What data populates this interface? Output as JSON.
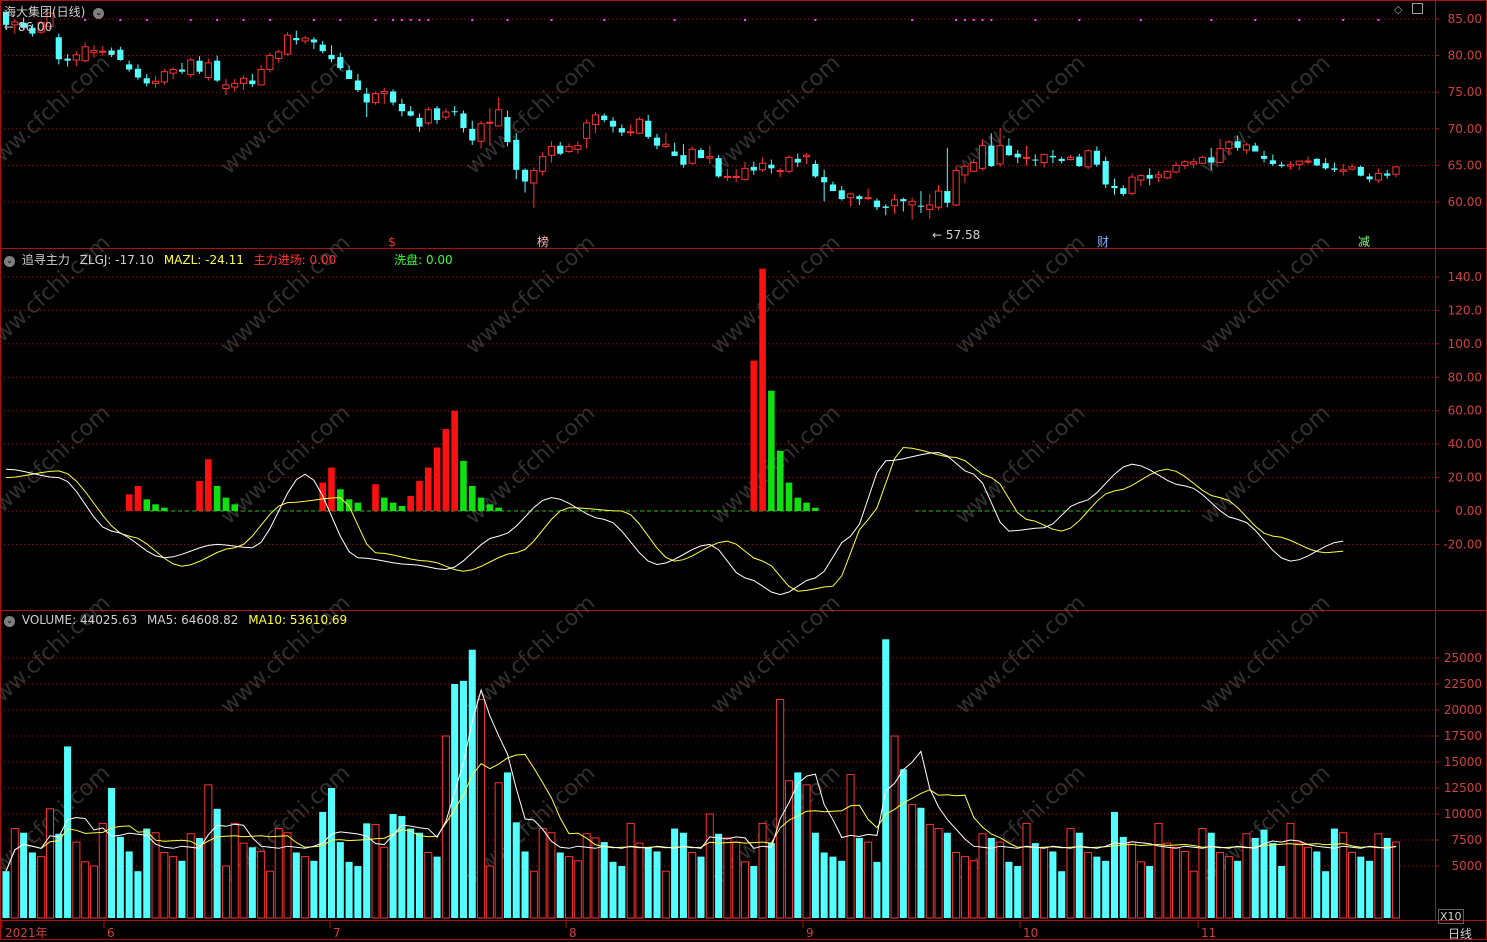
{
  "panel_top": {
    "title": "海大集团(日线)",
    "max_label": "86.00",
    "min_label": "57.58",
    "axis_ticks": [
      "85.00",
      "80.00",
      "75.00",
      "70.00",
      "65.00",
      "60.00"
    ],
    "markers": [
      "$",
      "榜",
      "财",
      "减"
    ],
    "colors": {
      "up": "#ff3232",
      "down": "#54ffff",
      "marker_s": "#ff3232",
      "marker_bang": "#ffb0b0",
      "marker_cai": "#7fb0ff",
      "marker_jian": "#7fff7f"
    }
  },
  "panel_mid": {
    "name": "追寻主力",
    "zlgj_label": "ZLGJ:",
    "zlgj_value": "-17.10",
    "mazl_label": "MAZL:",
    "mazl_value": "-24.11",
    "entry_label": "主力进场:",
    "entry_value": "0.00",
    "wash_label": "洗盘:",
    "wash_value": "0.00",
    "axis_ticks": [
      "140.0",
      "120.0",
      "100.0",
      "80.00",
      "60.00",
      "40.00",
      "20.00",
      "0.00",
      "-20.00"
    ]
  },
  "panel_vol": {
    "name": "VOLUME:",
    "value": "44025.63",
    "ma5_label": "MA5:",
    "ma5_value": "64608.82",
    "ma10_label": "MA10:",
    "ma10_value": "53610.69",
    "axis_ticks": [
      "25000",
      "22500",
      "20000",
      "17500",
      "15000",
      "12500",
      "10000",
      "7500",
      "5000"
    ],
    "multiplier": "X10"
  },
  "x_axis": {
    "labels": [
      "2021年",
      "6",
      "7",
      "8",
      "9",
      "10",
      "11"
    ],
    "period": "日线"
  },
  "watermark": "www.cfchi.com",
  "chart_data": {
    "type": "candlestick",
    "price": {
      "ylim": [
        57.0,
        86.5
      ],
      "ohlc": [
        [
          86.0,
          86.0,
          83.5,
          84.2
        ],
        [
          84.2,
          85.0,
          83.0,
          84.6
        ],
        [
          84.5,
          85.2,
          83.5,
          83.8
        ],
        [
          83.8,
          84.3,
          82.6,
          83.0
        ],
        [
          83.2,
          84.8,
          83.0,
          84.5
        ],
        [
          84.0,
          86.0,
          83.6,
          85.8
        ],
        [
          82.5,
          83.0,
          78.8,
          79.5
        ],
        [
          79.6,
          80.2,
          78.5,
          79.3
        ],
        [
          79.4,
          80.6,
          78.6,
          80.1
        ],
        [
          79.3,
          81.8,
          79.1,
          81.2
        ],
        [
          80.4,
          81.4,
          79.7,
          80.7
        ],
        [
          80.6,
          81.3,
          80.0,
          80.6
        ],
        [
          80.7,
          81.1,
          79.8,
          80.1
        ],
        [
          80.8,
          81.2,
          79.3,
          79.4
        ],
        [
          78.8,
          79.3,
          77.8,
          78.1
        ],
        [
          78.2,
          78.8,
          76.7,
          77.0
        ],
        [
          76.9,
          77.5,
          75.8,
          76.2
        ],
        [
          76.2,
          77.2,
          75.6,
          76.5
        ],
        [
          76.4,
          78.2,
          76.0,
          77.8
        ],
        [
          77.6,
          78.4,
          76.8,
          78.1
        ],
        [
          78.1,
          79.0,
          77.5,
          77.8
        ],
        [
          77.4,
          79.7,
          77.0,
          79.4
        ],
        [
          79.3,
          79.9,
          77.5,
          77.8
        ],
        [
          77.0,
          79.6,
          76.6,
          79.0
        ],
        [
          79.3,
          80.0,
          76.4,
          76.6
        ],
        [
          75.5,
          76.8,
          74.6,
          76.0
        ],
        [
          75.7,
          76.8,
          75.1,
          76.2
        ],
        [
          76.2,
          77.3,
          75.3,
          76.9
        ],
        [
          76.6,
          77.5,
          75.7,
          76.1
        ],
        [
          76.0,
          78.7,
          75.9,
          78.1
        ],
        [
          78.1,
          80.4,
          77.7,
          80.0
        ],
        [
          79.6,
          80.8,
          79.0,
          80.5
        ],
        [
          80.2,
          83.2,
          80.0,
          82.8
        ],
        [
          82.4,
          83.4,
          81.5,
          82.1
        ],
        [
          82.0,
          82.7,
          81.6,
          82.4
        ],
        [
          82.2,
          82.5,
          80.9,
          81.8
        ],
        [
          81.5,
          82.0,
          80.3,
          80.6
        ],
        [
          80.1,
          81.4,
          79.1,
          79.5
        ],
        [
          79.8,
          80.4,
          78.0,
          78.3
        ],
        [
          78.0,
          78.6,
          76.8,
          76.8
        ],
        [
          76.6,
          77.5,
          75.0,
          75.3
        ],
        [
          74.8,
          75.6,
          71.6,
          73.6
        ],
        [
          73.6,
          75.1,
          73.3,
          74.8
        ],
        [
          74.8,
          75.6,
          73.4,
          75.1
        ],
        [
          75.1,
          75.4,
          73.2,
          73.6
        ],
        [
          73.4,
          74.1,
          71.7,
          72.4
        ],
        [
          72.4,
          73.1,
          71.7,
          71.8
        ],
        [
          71.5,
          72.1,
          69.6,
          70.3
        ],
        [
          70.8,
          73.0,
          70.5,
          72.6
        ],
        [
          72.8,
          73.1,
          70.7,
          71.2
        ],
        [
          71.6,
          72.8,
          71.2,
          72.3
        ],
        [
          72.4,
          73.1,
          71.8,
          72.3
        ],
        [
          72.1,
          72.5,
          69.5,
          70.1
        ],
        [
          70.0,
          71.1,
          67.8,
          68.4
        ],
        [
          68.3,
          71.1,
          67.3,
          70.7
        ],
        [
          70.8,
          72.8,
          67.7,
          70.9
        ],
        [
          70.4,
          74.3,
          70.3,
          72.6
        ],
        [
          71.6,
          72.5,
          67.6,
          68.2
        ],
        [
          68.5,
          69.4,
          63.1,
          64.4
        ],
        [
          64.4,
          64.6,
          61.3,
          62.8
        ],
        [
          62.6,
          64.7,
          59.2,
          64.3
        ],
        [
          64.2,
          66.8,
          63.6,
          66.2
        ],
        [
          66.4,
          68.3,
          65.4,
          67.6
        ],
        [
          67.7,
          68.2,
          66.4,
          66.6
        ],
        [
          66.9,
          68.0,
          66.7,
          67.6
        ],
        [
          67.2,
          68.3,
          66.6,
          67.7
        ],
        [
          68.7,
          71.3,
          67.3,
          70.8
        ],
        [
          70.6,
          72.3,
          69.4,
          71.9
        ],
        [
          71.8,
          72.1,
          70.9,
          71.2
        ],
        [
          71.1,
          71.6,
          69.5,
          70.3
        ],
        [
          70.1,
          70.6,
          69.0,
          69.5
        ],
        [
          69.5,
          70.6,
          69.0,
          69.6
        ],
        [
          69.4,
          71.6,
          69.3,
          71.3
        ],
        [
          71.1,
          71.9,
          68.6,
          68.9
        ],
        [
          68.8,
          69.3,
          67.2,
          67.7
        ],
        [
          67.6,
          69.4,
          67.4,
          67.9
        ],
        [
          66.9,
          68.1,
          66.3,
          66.3
        ],
        [
          66.4,
          67.9,
          64.7,
          65.1
        ],
        [
          65.3,
          67.6,
          65.1,
          67.2
        ],
        [
          67.1,
          67.4,
          66.0,
          66.0
        ],
        [
          66.0,
          67.7,
          65.2,
          66.2
        ],
        [
          66.0,
          66.4,
          63.3,
          63.5
        ],
        [
          63.5,
          64.5,
          62.9,
          63.5
        ],
        [
          63.5,
          64.5,
          62.7,
          63.5
        ],
        [
          63.1,
          65.5,
          63.0,
          64.6
        ],
        [
          64.8,
          65.5,
          63.7,
          64.3
        ],
        [
          64.4,
          66.1,
          64.1,
          65.3
        ],
        [
          65.1,
          65.8,
          63.9,
          64.6
        ],
        [
          64.3,
          64.6,
          63.4,
          64.3
        ],
        [
          64.2,
          66.4,
          63.9,
          66.1
        ],
        [
          65.9,
          66.6,
          64.8,
          65.4
        ],
        [
          66.2,
          66.7,
          65.2,
          66.4
        ],
        [
          65.2,
          65.7,
          63.3,
          63.5
        ],
        [
          63.4,
          64.4,
          60.1,
          62.7
        ],
        [
          62.4,
          62.8,
          61.5,
          61.5
        ],
        [
          61.6,
          62.2,
          60.2,
          60.4
        ],
        [
          60.6,
          61.2,
          59.4,
          61.1
        ],
        [
          60.8,
          61.0,
          59.6,
          60.4
        ],
        [
          60.6,
          61.8,
          60.3,
          60.6
        ],
        [
          60.2,
          60.5,
          58.9,
          59.3
        ],
        [
          59.4,
          59.7,
          58.2,
          59.2
        ],
        [
          59.5,
          61.1,
          58.4,
          60.3
        ],
        [
          60.4,
          60.6,
          58.7,
          60.1
        ],
        [
          59.6,
          60.6,
          57.6,
          60.1
        ],
        [
          59.5,
          61.5,
          58.5,
          59.4
        ],
        [
          59.0,
          61.1,
          57.7,
          59.6
        ],
        [
          59.3,
          62.3,
          58.9,
          61.5
        ],
        [
          61.5,
          67.4,
          59.3,
          59.9
        ],
        [
          59.6,
          64.9,
          59.4,
          64.3
        ],
        [
          63.7,
          65.1,
          62.6,
          64.9
        ],
        [
          64.2,
          65.9,
          64.1,
          65.4
        ],
        [
          64.6,
          68.6,
          64.3,
          67.7
        ],
        [
          67.7,
          69.4,
          64.8,
          64.9
        ],
        [
          65.2,
          70.1,
          64.8,
          67.7
        ],
        [
          67.7,
          68.7,
          66.3,
          66.4
        ],
        [
          66.6,
          67.1,
          65.3,
          66.1
        ],
        [
          66.1,
          67.7,
          65.0,
          66.1
        ],
        [
          65.8,
          66.5,
          64.9,
          65.7
        ],
        [
          65.4,
          66.6,
          64.7,
          66.5
        ],
        [
          66.3,
          67.1,
          65.3,
          66.1
        ],
        [
          65.9,
          66.2,
          65.3,
          65.6
        ],
        [
          65.8,
          66.4,
          65.7,
          66.1
        ],
        [
          66.2,
          66.6,
          64.8,
          64.9
        ],
        [
          64.8,
          67.2,
          64.5,
          67.0
        ],
        [
          67.0,
          67.6,
          64.8,
          65.1
        ],
        [
          65.6,
          66.2,
          61.9,
          62.4
        ],
        [
          62.2,
          63.2,
          61.0,
          61.9
        ],
        [
          61.9,
          62.3,
          60.8,
          61.1
        ],
        [
          61.2,
          63.9,
          60.9,
          63.4
        ],
        [
          63.0,
          63.8,
          62.2,
          63.6
        ],
        [
          63.7,
          64.6,
          62.3,
          63.2
        ],
        [
          63.4,
          64.2,
          62.7,
          63.7
        ],
        [
          63.3,
          64.3,
          63.1,
          64.2
        ],
        [
          64.1,
          65.5,
          63.9,
          65.0
        ],
        [
          65.0,
          65.7,
          64.5,
          65.5
        ],
        [
          65.2,
          66.0,
          64.6,
          65.5
        ],
        [
          65.3,
          66.3,
          65.2,
          66.1
        ],
        [
          66.1,
          67.4,
          64.4,
          65.4
        ],
        [
          65.4,
          68.6,
          65.4,
          67.3
        ],
        [
          67.3,
          68.4,
          66.4,
          68.2
        ],
        [
          68.3,
          69.1,
          67.0,
          67.4
        ],
        [
          67.1,
          68.1,
          66.6,
          67.8
        ],
        [
          67.7,
          68.1,
          67.0,
          66.9
        ],
        [
          66.3,
          67.0,
          65.4,
          65.9
        ],
        [
          65.7,
          66.5,
          64.9,
          65.2
        ],
        [
          65.1,
          65.5,
          64.7,
          64.9
        ],
        [
          64.9,
          65.6,
          64.4,
          65.1
        ],
        [
          65.1,
          65.6,
          64.4,
          65.6
        ],
        [
          65.5,
          66.2,
          65.2,
          65.6
        ],
        [
          65.9,
          66.0,
          64.9,
          65.0
        ],
        [
          65.3,
          66.0,
          64.4,
          64.6
        ],
        [
          64.6,
          65.4,
          64.1,
          64.4
        ],
        [
          64.2,
          65.2,
          63.6,
          64.4
        ],
        [
          64.5,
          65.2,
          64.3,
          64.8
        ],
        [
          64.8,
          65.0,
          63.5,
          63.6
        ],
        [
          63.5,
          63.9,
          62.7,
          63.1
        ],
        [
          63.0,
          64.6,
          62.6,
          63.9
        ],
        [
          63.9,
          64.4,
          63.2,
          63.6
        ],
        [
          63.8,
          64.9,
          63.4,
          64.8
        ]
      ],
      "max_value": 86.0,
      "min_value": 57.58
    },
    "zlgj_bars": {
      "note_units": "indicator units (0 baseline)",
      "red": {
        "14": 10,
        "15": 15,
        "22": 18,
        "23": 31,
        "36": 17,
        "37": 26,
        "42": 16,
        "46": 9,
        "47": 18,
        "48": 26,
        "49": 38,
        "50": 49,
        "51": 60,
        "85": 90,
        "86": 145
      },
      "green": {
        "16": 7,
        "17": 4,
        "18": 2,
        "24": 15,
        "25": 8,
        "26": 4,
        "38": 13,
        "39": 7,
        "40": 5,
        "43": 8,
        "44": 5,
        "45": 3,
        "52": 30,
        "53": 15,
        "54": 8,
        "55": 4,
        "56": 2,
        "87": 72,
        "88": 36,
        "89": 17,
        "90": 8,
        "91": 5,
        "92": 2
      }
    },
    "volume_ylim": [
      0,
      27500
    ]
  }
}
